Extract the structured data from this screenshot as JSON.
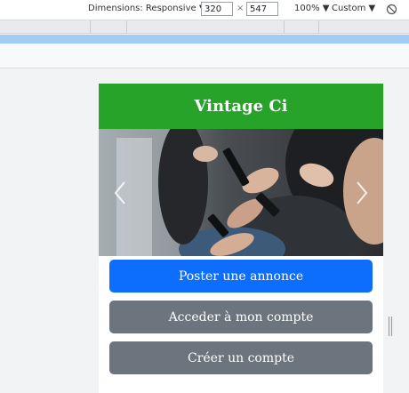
{
  "toolbar": {
    "dimensions_label": "Dimensions: Responsive",
    "width_value": "320",
    "times_symbol": "×",
    "height_value": "547",
    "zoom_label": "100%",
    "throttle_label": "Custom"
  },
  "site": {
    "title": "Vintage Ci",
    "header_color": "#28a32a",
    "buttons": {
      "post_ad": "Poster une annonce",
      "my_account": "Acceder à mon compte",
      "create_account": "Créer un compte"
    },
    "colors": {
      "primary": "#0d6efd",
      "secondary": "#6c757d"
    }
  },
  "icons": {
    "dropdown": "chevron-down-icon",
    "rotate": "rotate-icon",
    "carousel_prev": "chevron-left-icon",
    "carousel_next": "chevron-right-icon"
  }
}
